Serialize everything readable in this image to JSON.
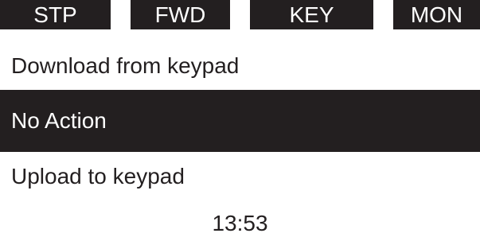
{
  "status_bar": {
    "items": [
      "STP",
      "FWD",
      "KEY",
      "MON"
    ]
  },
  "menu": {
    "items": [
      {
        "label": "Download from keypad",
        "selected": false
      },
      {
        "label": "No Action",
        "selected": true
      },
      {
        "label": "Upload to keypad",
        "selected": false
      }
    ]
  },
  "clock": "13:53",
  "colors": {
    "foreground": "#231f20",
    "background": "#ffffff"
  }
}
